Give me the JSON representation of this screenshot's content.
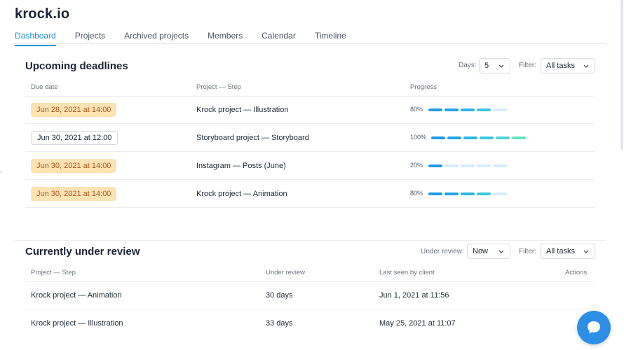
{
  "app": {
    "brand": "krock.io"
  },
  "nav": {
    "tabs": [
      {
        "label": "Dashboard",
        "active": true
      },
      {
        "label": "Projects"
      },
      {
        "label": "Archived projects"
      },
      {
        "label": "Members"
      },
      {
        "label": "Calendar"
      },
      {
        "label": "Timeline"
      }
    ]
  },
  "deadlines": {
    "title": "Upcoming deadlines",
    "days_label": "Days:",
    "days_value": "5",
    "filter_label": "Filter:",
    "filter_value": "All tasks",
    "columns": [
      "Due date",
      "Project — Step",
      "Progress"
    ],
    "rows": [
      {
        "due": "Jun 28, 2021 at 14:00",
        "status": "overdue",
        "project": "Krock project — Illustration",
        "progress_label": "80%",
        "progress": 0.8
      },
      {
        "due": "Jun 30, 2021 at 12:00",
        "status": "normal",
        "project": "Storyboard project — Storyboard",
        "progress_label": "100%",
        "progress": 1.0
      },
      {
        "due": "Jun 30, 2021 at 14:00",
        "status": "overdue",
        "project": "Instagram — Posts (June)",
        "progress_label": "20%",
        "progress": 0.2
      },
      {
        "due": "Jun 30, 2021 at 14:00",
        "status": "overdue",
        "project": "Krock project — Animation",
        "progress_label": "80%",
        "progress": 0.8
      }
    ]
  },
  "review": {
    "title": "Currently under review",
    "under_review_label": "Under review:",
    "under_review_value": "Now",
    "filter_label": "Filter:",
    "filter_value": "All tasks",
    "columns": [
      "Project — Step",
      "Under review",
      "Last seen by client",
      "Actions"
    ],
    "rows": [
      {
        "project": "Krock project — Animation",
        "under_review": "30 days",
        "last_seen": "Jun 1, 2021 at 11:56"
      },
      {
        "project": "Krock project — Illustration",
        "under_review": "33 days",
        "last_seen": "May 25, 2021 at 11:07"
      }
    ]
  },
  "colors": {
    "accent": "#1d8fe0",
    "overdue_bg": "#fbe3b4",
    "overdue_text": "#b4541a",
    "progress_filled": [
      "#1e9be8",
      "#22a6ea",
      "#2cb7ea",
      "#3ac7e2",
      "#4fd8d2",
      "#63e4c0"
    ],
    "progress_empty": "#d4ebfb"
  },
  "icons": {
    "chevron": "chevron-down-icon",
    "chat": "chat-bubble-icon",
    "edge": "chevron-right-icon"
  }
}
